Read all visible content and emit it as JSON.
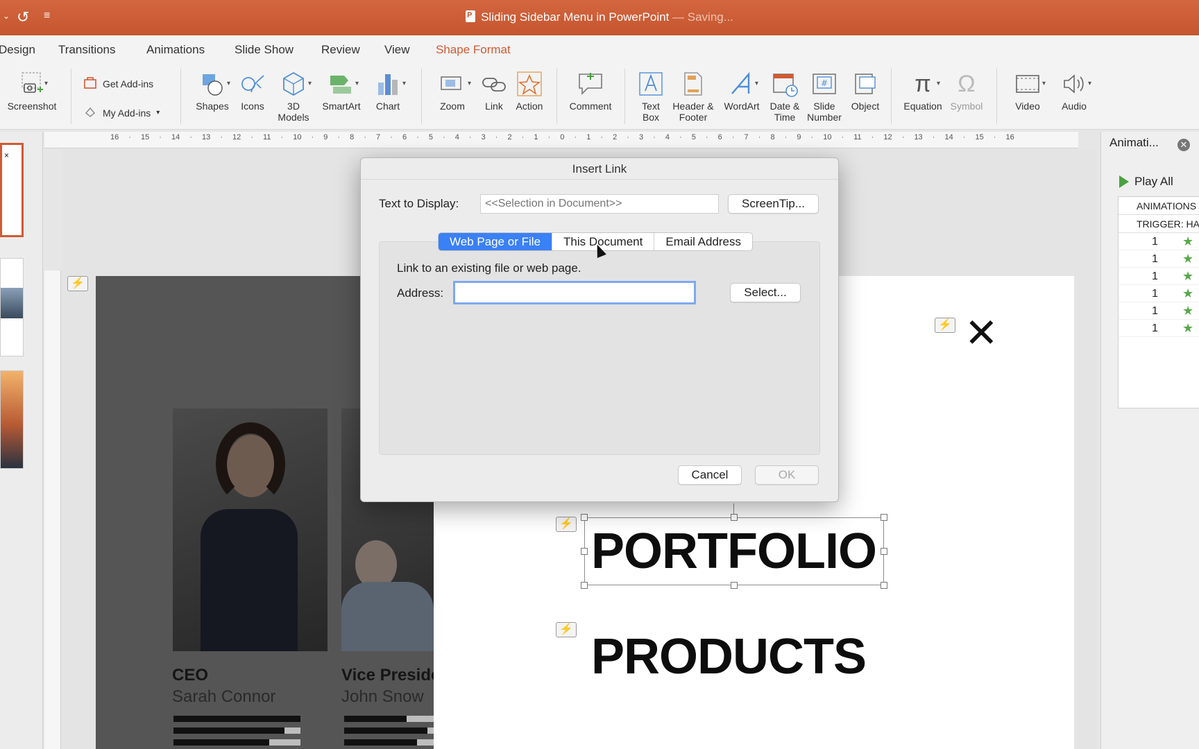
{
  "titlebar": {
    "title": "Sliding Sidebar Menu in PowerPoint",
    "status": " — Saving..."
  },
  "ribbon_tabs": [
    "Design",
    "Transitions",
    "Animations",
    "Slide Show",
    "Review",
    "View",
    "Shape Format"
  ],
  "active_tab": "Shape Format",
  "ribbon": {
    "screenshot": "Screenshot",
    "get_addins": "Get Add-ins",
    "my_addins": "My Add-ins",
    "shapes": "Shapes",
    "icons": "Icons",
    "models_3d_1": "3D",
    "models_3d_2": "Models",
    "smartart": "SmartArt",
    "chart": "Chart",
    "zoom": "Zoom",
    "link": "Link",
    "action": "Action",
    "comment": "Comment",
    "textbox_1": "Text",
    "textbox_2": "Box",
    "header_1": "Header &",
    "header_2": "Footer",
    "wordart": "WordArt",
    "datetime_1": "Date &",
    "datetime_2": "Time",
    "slidenum_1": "Slide",
    "slidenum_2": "Number",
    "object": "Object",
    "equation": "Equation",
    "symbol": "Symbol",
    "video": "Video",
    "audio": "Audio"
  },
  "ruler_numbers": "16 · 15 · 14 · 13 · 12 · 11 · 10 · 9 · 8 · 7 · 6 · 5 · 4 · 3 · 2 · 1 · 0 · 1 · 2 · 3 · 4 · 5 · 6 · 7 · 8 · 9 · 10 · 11 · 12 · 13 · 14 · 15 · 16",
  "slide": {
    "person1_role": "CEO",
    "person1_name": "Sarah Connor",
    "person2_role": "Vice Preside",
    "person2_name": "John Snow",
    "portfolio": "PORTFOLIO",
    "products": "PRODUCTS"
  },
  "animation_pane": {
    "title": "Animati...",
    "play_all": "Play All",
    "header1": "ANIMATIONS",
    "header2": "TRIGGER: HA",
    "rows": [
      "1",
      "1",
      "1",
      "1",
      "1",
      "1"
    ]
  },
  "dialog": {
    "title": "Insert Link",
    "text_to_display_label": "Text to Display:",
    "text_to_display_placeholder": "<<Selection in Document>>",
    "screentip_button": "ScreenTip...",
    "tabs": [
      "Web Page or File",
      "This Document",
      "Email Address"
    ],
    "active_tab": "Web Page or File",
    "description": "Link to an existing file or web page.",
    "address_label": "Address:",
    "address_value": "",
    "select_button": "Select...",
    "cancel_button": "Cancel",
    "ok_button": "OK"
  },
  "colors": {
    "titlebar": "#c9592f",
    "active_tab": "#d05a33",
    "dialog_tab_selected": "#3a80f6",
    "animation_star": "#58a84a"
  }
}
